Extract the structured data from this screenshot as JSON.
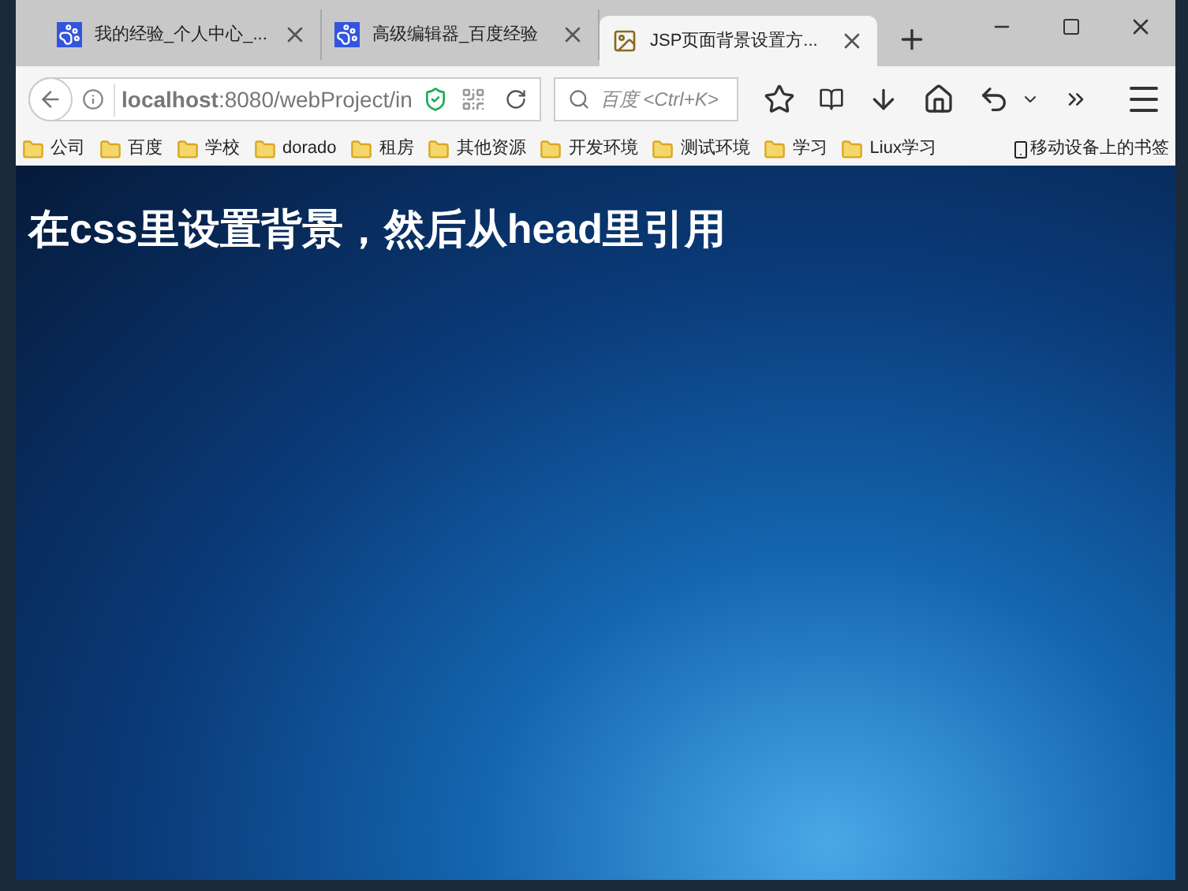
{
  "tabs": [
    {
      "title": "我的经验_个人中心_...",
      "selected": false,
      "kind": "paw"
    },
    {
      "title": "高级编辑器_百度经验",
      "selected": false,
      "kind": "paw"
    },
    {
      "title": "JSP页面背景设置方...",
      "selected": true,
      "kind": "image"
    }
  ],
  "address": "**localhost**:8080/webProject/in",
  "search": {
    "placeholder": "百度 <Ctrl+K>"
  },
  "bookmarks": [
    "公司",
    "百度",
    "学校",
    "dorado",
    "租房",
    "其他资源",
    "开发环境",
    "测试环境",
    "学习",
    "Liux学习"
  ],
  "mobile_bookmarks": "移动设备上的书签",
  "page": {
    "heading": "在css里设置背景，然后从head里引用"
  }
}
